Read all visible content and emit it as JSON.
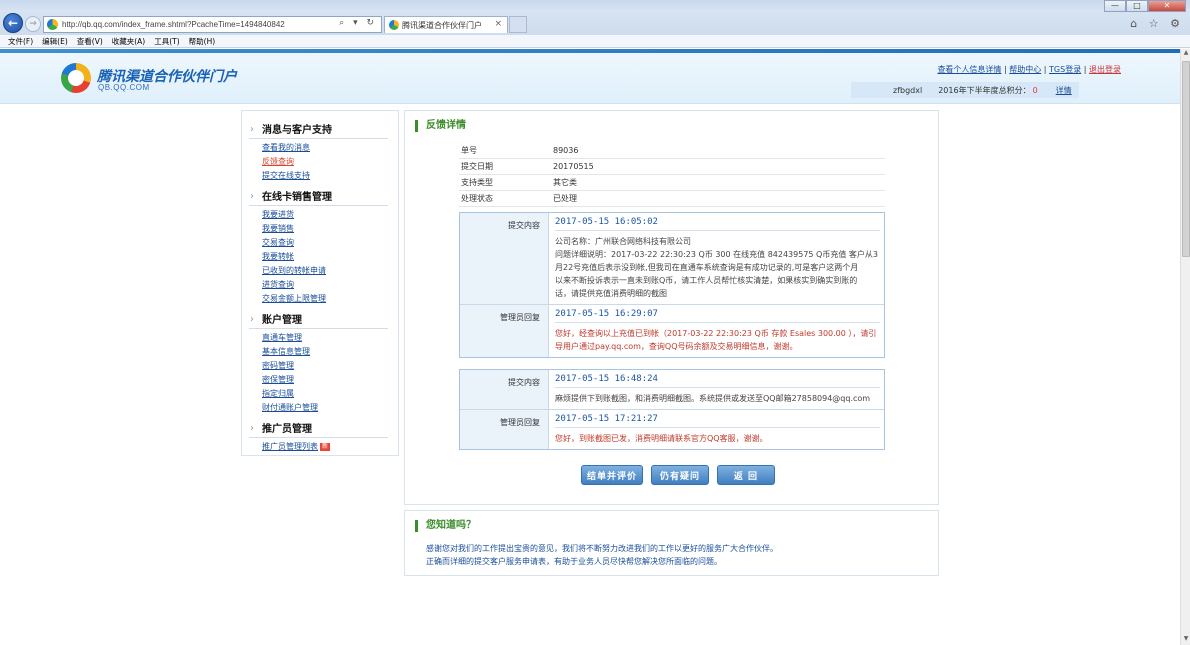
{
  "browser": {
    "url": "http://qb.qq.com/index_frame.shtml?PcacheTime=1494840842",
    "address_icons": "⌕ ▾ ↻",
    "tab_title": "腾讯渠道合作伙伴门户",
    "tab_close": "×",
    "back": "←",
    "forward": "→",
    "window_controls": [
      "—",
      "□",
      "✕"
    ],
    "toolbar_icons": "⌂ ☆ ⚙",
    "menu": [
      "文件(F)",
      "编辑(E)",
      "查看(V)",
      "收藏夹(A)",
      "工具(T)",
      "帮助(H)"
    ]
  },
  "header": {
    "title": "腾讯渠道合作伙伴门户",
    "subtitle": "QB.QQ.COM",
    "links": [
      "查看个人信息详情",
      "帮助中心",
      "TGS登录",
      "退出登录"
    ],
    "separator": "|",
    "username": "zfbgdxl",
    "points_label": "2016年下半年度总积分：",
    "points_value": "0",
    "details_link": "详情"
  },
  "sidebar": {
    "groups": [
      {
        "title": "消息与客户支持",
        "links": [
          "查看我的消息",
          "反馈查询",
          "提交在线支持"
        ]
      },
      {
        "title": "在线卡销售管理",
        "links": [
          "我要进货",
          "我要销售",
          "交易查询",
          "我要转帐",
          "已收到的转帐申请",
          "进货查询",
          "交易金额上限管理"
        ]
      },
      {
        "title": "账户管理",
        "links": [
          "直通车管理",
          "基本信息管理",
          "密码管理",
          "密保管理",
          "指定归属",
          "财付通账户管理"
        ]
      },
      {
        "title": "推广员管理",
        "links": [
          "推广员管理列表"
        ],
        "badge": "新"
      }
    ]
  },
  "main": {
    "section_title": "反馈详情",
    "info": [
      {
        "label": "单号",
        "value": "89036"
      },
      {
        "label": "提交日期",
        "value": "20170515"
      },
      {
        "label": "支持类型",
        "value": "其它类"
      },
      {
        "label": "处理状态",
        "value": "已处理"
      }
    ],
    "thread1": [
      {
        "label": "提交内容",
        "time": "2017-05-15 16:05:02",
        "lines": [
          "公司名称：广州联合网络科技有限公司",
          "问题详细说明：2017-03-22 22:30:23 Q币 300 在线充值 842439575 Q币充值 客户从3",
          "月22号充值后表示没到帐,但我司在直通车系统查询是有成功记录的,可是客户这两个月",
          "以来不断投诉表示一直未到账Q币，请工作人员帮忙核实清楚，如果核实到确实到账的",
          "话，请提供充值消费明细的截图"
        ]
      },
      {
        "label": "管理员回复",
        "time": "2017-05-15 16:29:07",
        "lines": [
          "您好，经查询以上充值已到帐（2017-03-22 22:30:23 Q币 存款 Esales 300.00 ），请引",
          "导用户通过pay.qq.com，查询QQ号码余额及交易明细信息，谢谢。"
        ]
      }
    ],
    "thread2": [
      {
        "label": "提交内容",
        "time": "2017-05-15 16:48:24",
        "lines": [
          "麻烦提供下到账截图，和消费明细截图。系统提供或发送至QQ邮箱27858094@qq.com"
        ]
      },
      {
        "label": "管理员回复",
        "time": "2017-05-15 17:21:27",
        "lines": [
          "您好，到账截图已发，消费明细请联系官方QQ客服，谢谢。"
        ]
      }
    ],
    "buttons": {
      "close": "结单并评价",
      "doubt": "仍有疑问",
      "back": "返 回"
    }
  },
  "tips": {
    "title": "您知道吗？",
    "lines": [
      "感谢您对我们的工作提出宝贵的意见，我们将不断努力改进我们的工作以更好的服务广大合作伙伴。",
      "正确而详细的提交客户服务申请表，有助于业务人员尽快帮您解决您所面临的问题。"
    ]
  },
  "scrollbar": {
    "up": "▲",
    "down": "▼"
  }
}
